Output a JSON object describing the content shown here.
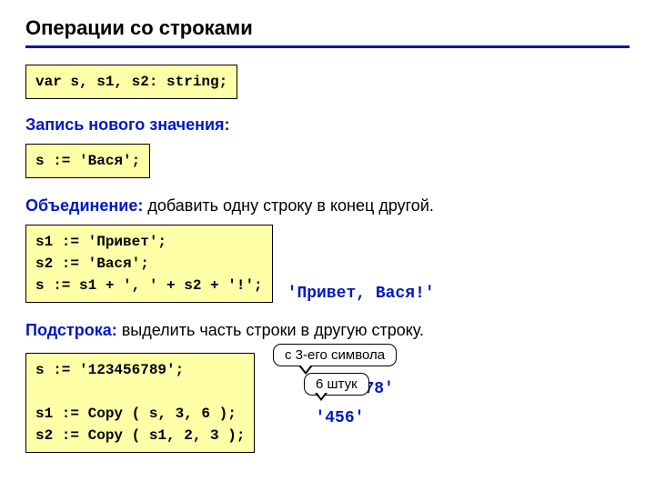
{
  "title": "Операции со строками",
  "code_decl": "var s, s1, s2: string;",
  "section1": {
    "heading": "Запись нового значения:",
    "code": "s := 'Вася';"
  },
  "section2": {
    "heading_bold": "Объединение:",
    "heading_rest": " добавить одну строку в конец другой.",
    "code": "s1 := 'Привет';\ns2 := 'Вася';\ns := s1 + ', ' + s2 + '!';",
    "result": "'Привет, Вася!'"
  },
  "section3": {
    "heading_bold": "Подстрока:",
    "heading_rest": " выделить часть строки в другую строку.",
    "code": "s := '123456789';\n\ns1 := Copy ( s, 3, 6 );\ns2 := Copy ( s1, 2, 3 );",
    "callout1": "с 3-его символа",
    "callout2": "6 штук",
    "result1": "'345678'",
    "result2": "'456'"
  }
}
